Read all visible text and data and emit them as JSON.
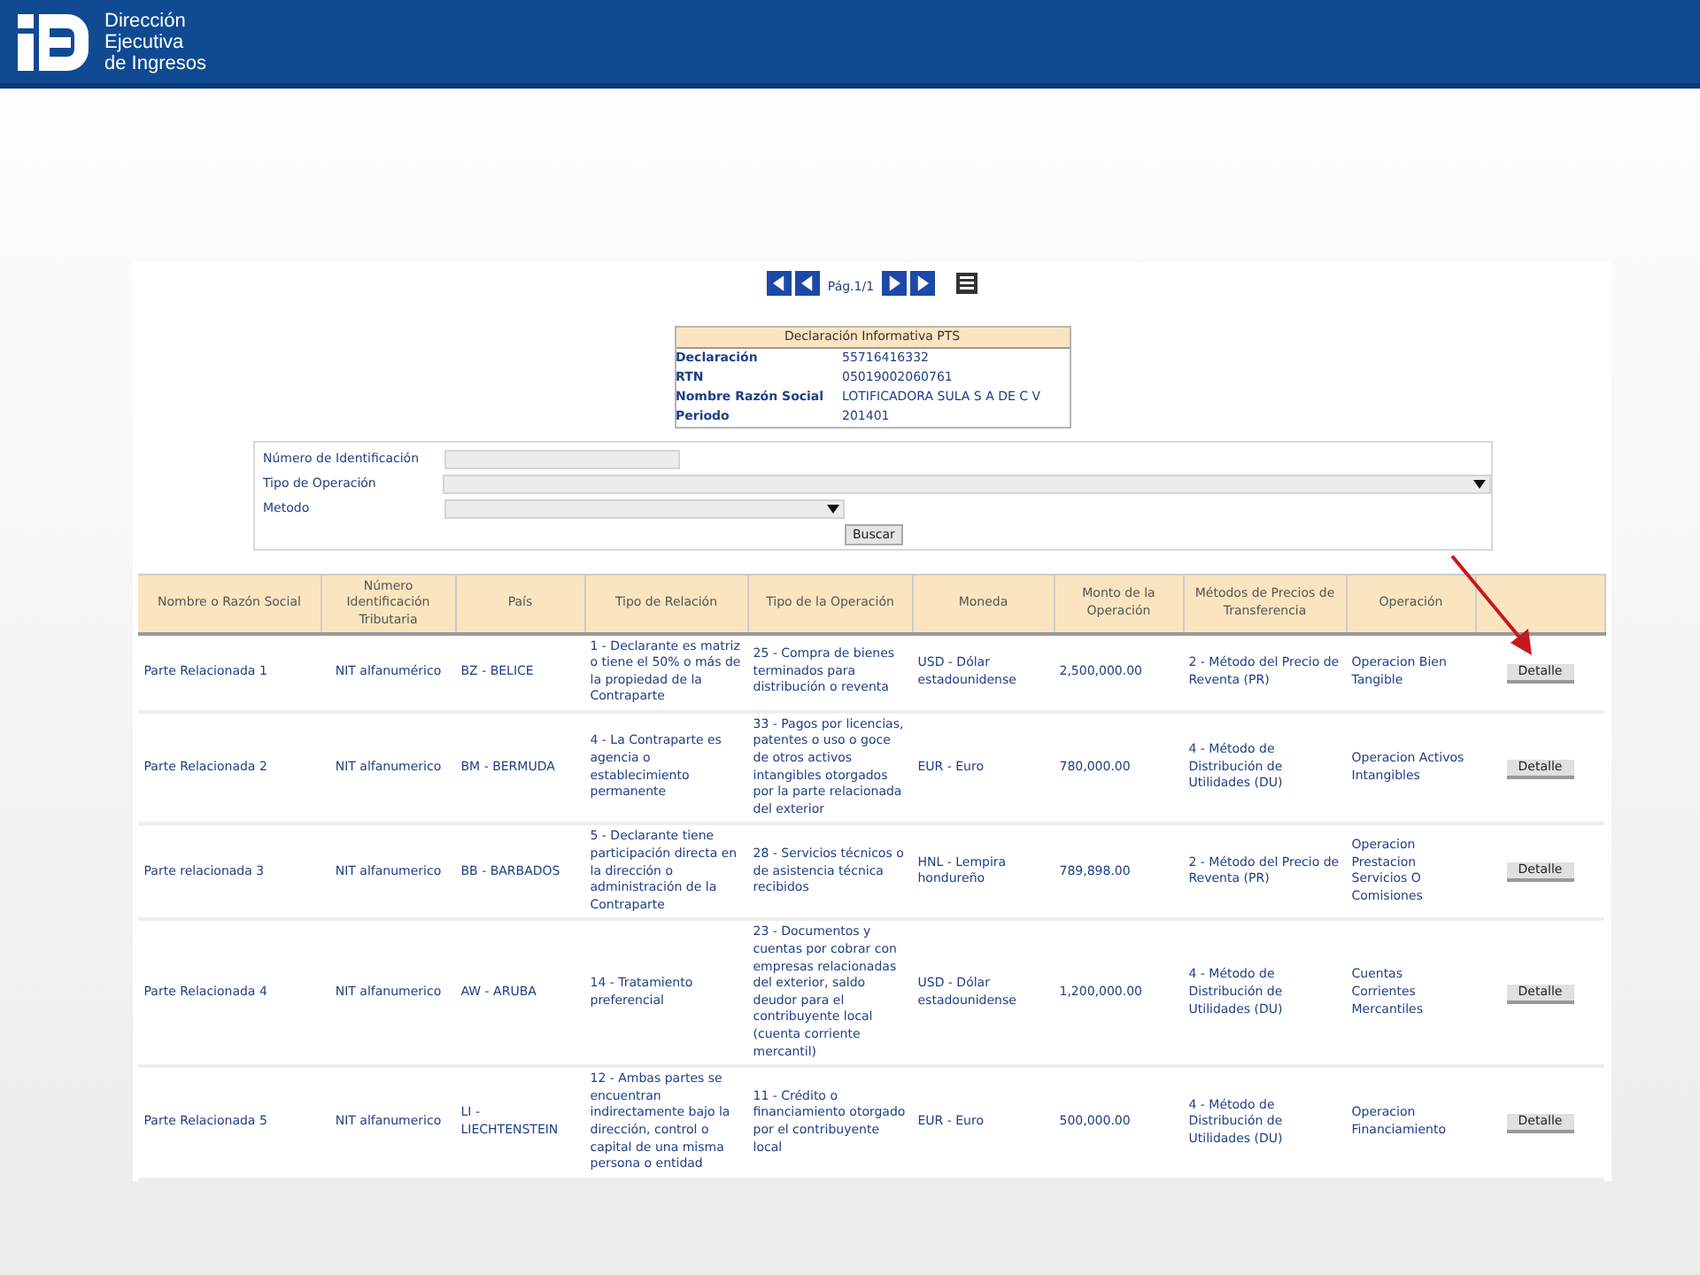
{
  "header": {
    "logo_text": [
      "Dirección",
      "Ejecutiva",
      "de Ingresos"
    ]
  },
  "pager": {
    "label": "Pág.1/1"
  },
  "summary": {
    "title": "Declaración Informativa PTS",
    "fields": [
      {
        "label": "Declaración",
        "value": "55716416332"
      },
      {
        "label": "RTN",
        "value": "05019002060761"
      },
      {
        "label": "Nombre Razón Social",
        "value": "LOTIFICADORA SULA S A DE C V"
      },
      {
        "label": "Periodo",
        "value": "201401"
      }
    ]
  },
  "filters": {
    "fields": [
      {
        "label": "Número de Identificación",
        "kind": "text"
      },
      {
        "label": "Tipo de Operación",
        "kind": "select-wide"
      },
      {
        "label": "Metodo",
        "kind": "select"
      }
    ],
    "button": "Buscar"
  },
  "table": {
    "columns": [
      "Nombre o Razón Social",
      "Número Identificación Tributaria",
      "País",
      "Tipo de Relación",
      "Tipo de la Operación",
      "Moneda",
      "Monto de la Operación",
      "Métodos de Precios de Transferencia",
      "Operación"
    ],
    "rows": [
      {
        "cells": [
          "Parte Relacionada 1",
          "NIT alfanumérico",
          "BZ - BELICE",
          "1 - Declarante es matriz o tiene el 50% o más de la propiedad de la Contraparte",
          "25 - Compra de bienes terminados para distribución o reventa",
          "USD - Dólar estadounidense",
          "2,500,000.00",
          "2 - Método del Precio de Reventa (PR)",
          "Operacion Bien Tangible"
        ],
        "action": "Detalle"
      },
      {
        "cells": [
          "Parte Relacionada 2",
          "NIT alfanumerico",
          "BM - BERMUDA",
          "4 - La Contraparte es agencia o establecimiento permanente",
          "33 - Pagos por licencias, patentes o uso o goce de otros activos intangibles otorgados por la parte relacionada del exterior",
          "EUR - Euro",
          "780,000.00",
          "4 - Método de Distribución de Utilidades (DU)",
          "Operacion Activos Intangibles"
        ],
        "action": "Detalle"
      },
      {
        "cells": [
          "Parte relacionada 3",
          "NIT alfanumerico",
          "BB - BARBADOS",
          "5 - Declarante tiene participación directa en la dirección o administración de la Contraparte",
          "28 - Servicios técnicos o de asistencia técnica recibidos",
          "HNL - Lempira hondureño",
          "789,898.00",
          "2 - Método del Precio de Reventa (PR)",
          "Operacion Prestacion Servicios O Comisiones"
        ],
        "action": "Detalle"
      },
      {
        "cells": [
          "Parte Relacionada 4",
          "NIT alfanumerico",
          "AW - ARUBA",
          "14 - Tratamiento preferencial",
          "23 - Documentos y cuentas por cobrar con empresas relacionadas del exterior, saldo deudor para el contribuyente local (cuenta corriente mercantil)",
          "USD - Dólar estadounidense",
          "1,200,000.00",
          "4 - Método de Distribución de Utilidades (DU)",
          "Cuentas Corrientes Mercantiles"
        ],
        "action": "Detalle"
      },
      {
        "cells": [
          "Parte Relacionada 5",
          "NIT alfanumerico",
          "LI - LIECHTENSTEIN",
          "12 - Ambas partes se encuentran indirectamente bajo la dirección, control o capital de una misma persona o entidad",
          "11 - Crédito o financiamiento otorgado por el contribuyente local",
          "EUR - Euro",
          "500,000.00",
          "4 - Método de Distribución de Utilidades (DU)",
          "Operacion Financiamiento"
        ],
        "action": "Detalle"
      }
    ]
  }
}
